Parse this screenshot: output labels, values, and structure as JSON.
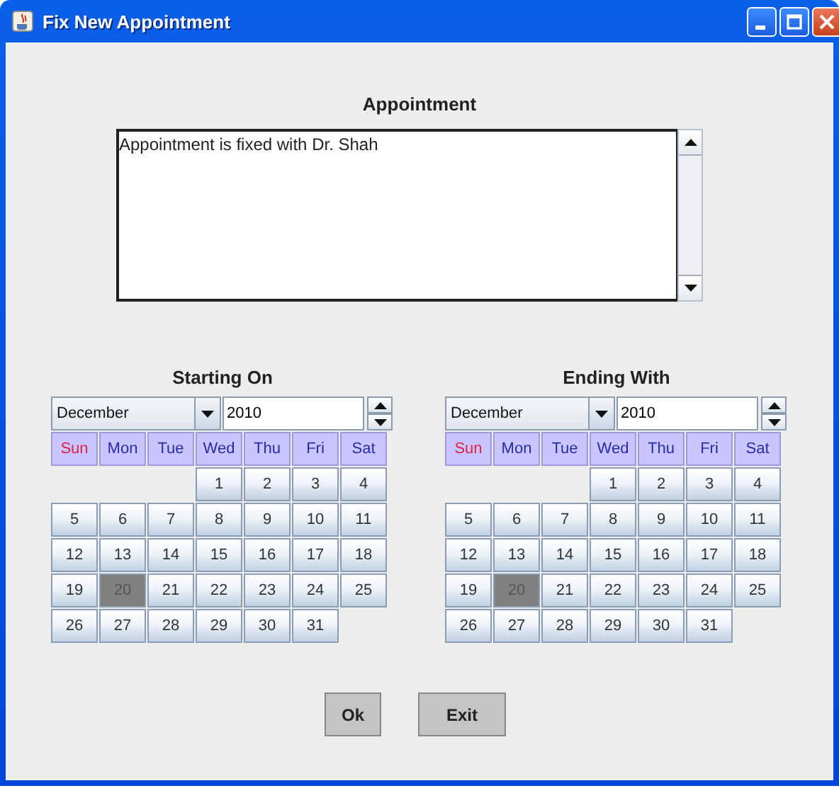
{
  "window": {
    "title": "Fix New Appointment"
  },
  "appointment": {
    "label": "Appointment",
    "text": "Appointment is fixed with Dr. Shah"
  },
  "calendars": [
    {
      "title": "Starting On",
      "month": "December",
      "year": "2010",
      "weekdays": [
        {
          "label": "Sun",
          "color": "#e0204a"
        },
        {
          "label": "Mon",
          "color": "#2a2aa8"
        },
        {
          "label": "Tue",
          "color": "#2a2aa8"
        },
        {
          "label": "Wed",
          "color": "#2a2aa8"
        },
        {
          "label": "Thu",
          "color": "#2a2aa8"
        },
        {
          "label": "Fri",
          "color": "#2a2aa8"
        },
        {
          "label": "Sat",
          "color": "#2a2aa8"
        }
      ],
      "weeks": [
        [
          {
            "kind": "blank"
          },
          {
            "kind": "blank"
          },
          {
            "kind": "blank"
          },
          {
            "kind": "day",
            "label": "1",
            "selected": false
          },
          {
            "kind": "day",
            "label": "2",
            "selected": false
          },
          {
            "kind": "day",
            "label": "3",
            "selected": false
          },
          {
            "kind": "day",
            "label": "4",
            "selected": false
          }
        ],
        [
          {
            "kind": "day",
            "label": "5",
            "selected": false
          },
          {
            "kind": "day",
            "label": "6",
            "selected": false
          },
          {
            "kind": "day",
            "label": "7",
            "selected": false
          },
          {
            "kind": "day",
            "label": "8",
            "selected": false
          },
          {
            "kind": "day",
            "label": "9",
            "selected": false
          },
          {
            "kind": "day",
            "label": "10",
            "selected": false
          },
          {
            "kind": "day",
            "label": "11",
            "selected": false
          }
        ],
        [
          {
            "kind": "day",
            "label": "12",
            "selected": false
          },
          {
            "kind": "day",
            "label": "13",
            "selected": false
          },
          {
            "kind": "day",
            "label": "14",
            "selected": false
          },
          {
            "kind": "day",
            "label": "15",
            "selected": false
          },
          {
            "kind": "day",
            "label": "16",
            "selected": false
          },
          {
            "kind": "day",
            "label": "17",
            "selected": false
          },
          {
            "kind": "day",
            "label": "18",
            "selected": false
          }
        ],
        [
          {
            "kind": "day",
            "label": "19",
            "selected": false
          },
          {
            "kind": "day",
            "label": "20",
            "selected": true
          },
          {
            "kind": "day",
            "label": "21",
            "selected": false
          },
          {
            "kind": "day",
            "label": "22",
            "selected": false
          },
          {
            "kind": "day",
            "label": "23",
            "selected": false
          },
          {
            "kind": "day",
            "label": "24",
            "selected": false
          },
          {
            "kind": "day",
            "label": "25",
            "selected": false
          }
        ],
        [
          {
            "kind": "day",
            "label": "26",
            "selected": false
          },
          {
            "kind": "day",
            "label": "27",
            "selected": false
          },
          {
            "kind": "day",
            "label": "28",
            "selected": false
          },
          {
            "kind": "day",
            "label": "29",
            "selected": false
          },
          {
            "kind": "day",
            "label": "30",
            "selected": false
          },
          {
            "kind": "day",
            "label": "31",
            "selected": false
          },
          {
            "kind": "blank"
          }
        ]
      ]
    },
    {
      "title": "Ending With",
      "month": "December",
      "year": "2010",
      "weekdays": [
        {
          "label": "Sun",
          "color": "#e0204a"
        },
        {
          "label": "Mon",
          "color": "#2a2aa8"
        },
        {
          "label": "Tue",
          "color": "#2a2aa8"
        },
        {
          "label": "Wed",
          "color": "#2a2aa8"
        },
        {
          "label": "Thu",
          "color": "#2a2aa8"
        },
        {
          "label": "Fri",
          "color": "#2a2aa8"
        },
        {
          "label": "Sat",
          "color": "#2a2aa8"
        }
      ],
      "weeks": [
        [
          {
            "kind": "blank"
          },
          {
            "kind": "blank"
          },
          {
            "kind": "blank"
          },
          {
            "kind": "day",
            "label": "1",
            "selected": false
          },
          {
            "kind": "day",
            "label": "2",
            "selected": false
          },
          {
            "kind": "day",
            "label": "3",
            "selected": false
          },
          {
            "kind": "day",
            "label": "4",
            "selected": false
          }
        ],
        [
          {
            "kind": "day",
            "label": "5",
            "selected": false
          },
          {
            "kind": "day",
            "label": "6",
            "selected": false
          },
          {
            "kind": "day",
            "label": "7",
            "selected": false
          },
          {
            "kind": "day",
            "label": "8",
            "selected": false
          },
          {
            "kind": "day",
            "label": "9",
            "selected": false
          },
          {
            "kind": "day",
            "label": "10",
            "selected": false
          },
          {
            "kind": "day",
            "label": "11",
            "selected": false
          }
        ],
        [
          {
            "kind": "day",
            "label": "12",
            "selected": false
          },
          {
            "kind": "day",
            "label": "13",
            "selected": false
          },
          {
            "kind": "day",
            "label": "14",
            "selected": false
          },
          {
            "kind": "day",
            "label": "15",
            "selected": false
          },
          {
            "kind": "day",
            "label": "16",
            "selected": false
          },
          {
            "kind": "day",
            "label": "17",
            "selected": false
          },
          {
            "kind": "day",
            "label": "18",
            "selected": false
          }
        ],
        [
          {
            "kind": "day",
            "label": "19",
            "selected": false
          },
          {
            "kind": "day",
            "label": "20",
            "selected": true
          },
          {
            "kind": "day",
            "label": "21",
            "selected": false
          },
          {
            "kind": "day",
            "label": "22",
            "selected": false
          },
          {
            "kind": "day",
            "label": "23",
            "selected": false
          },
          {
            "kind": "day",
            "label": "24",
            "selected": false
          },
          {
            "kind": "day",
            "label": "25",
            "selected": false
          }
        ],
        [
          {
            "kind": "day",
            "label": "26",
            "selected": false
          },
          {
            "kind": "day",
            "label": "27",
            "selected": false
          },
          {
            "kind": "day",
            "label": "28",
            "selected": false
          },
          {
            "kind": "day",
            "label": "29",
            "selected": false
          },
          {
            "kind": "day",
            "label": "30",
            "selected": false
          },
          {
            "kind": "day",
            "label": "31",
            "selected": false
          },
          {
            "kind": "blank"
          }
        ]
      ]
    }
  ],
  "buttons": [
    "Ok",
    "Exit"
  ]
}
